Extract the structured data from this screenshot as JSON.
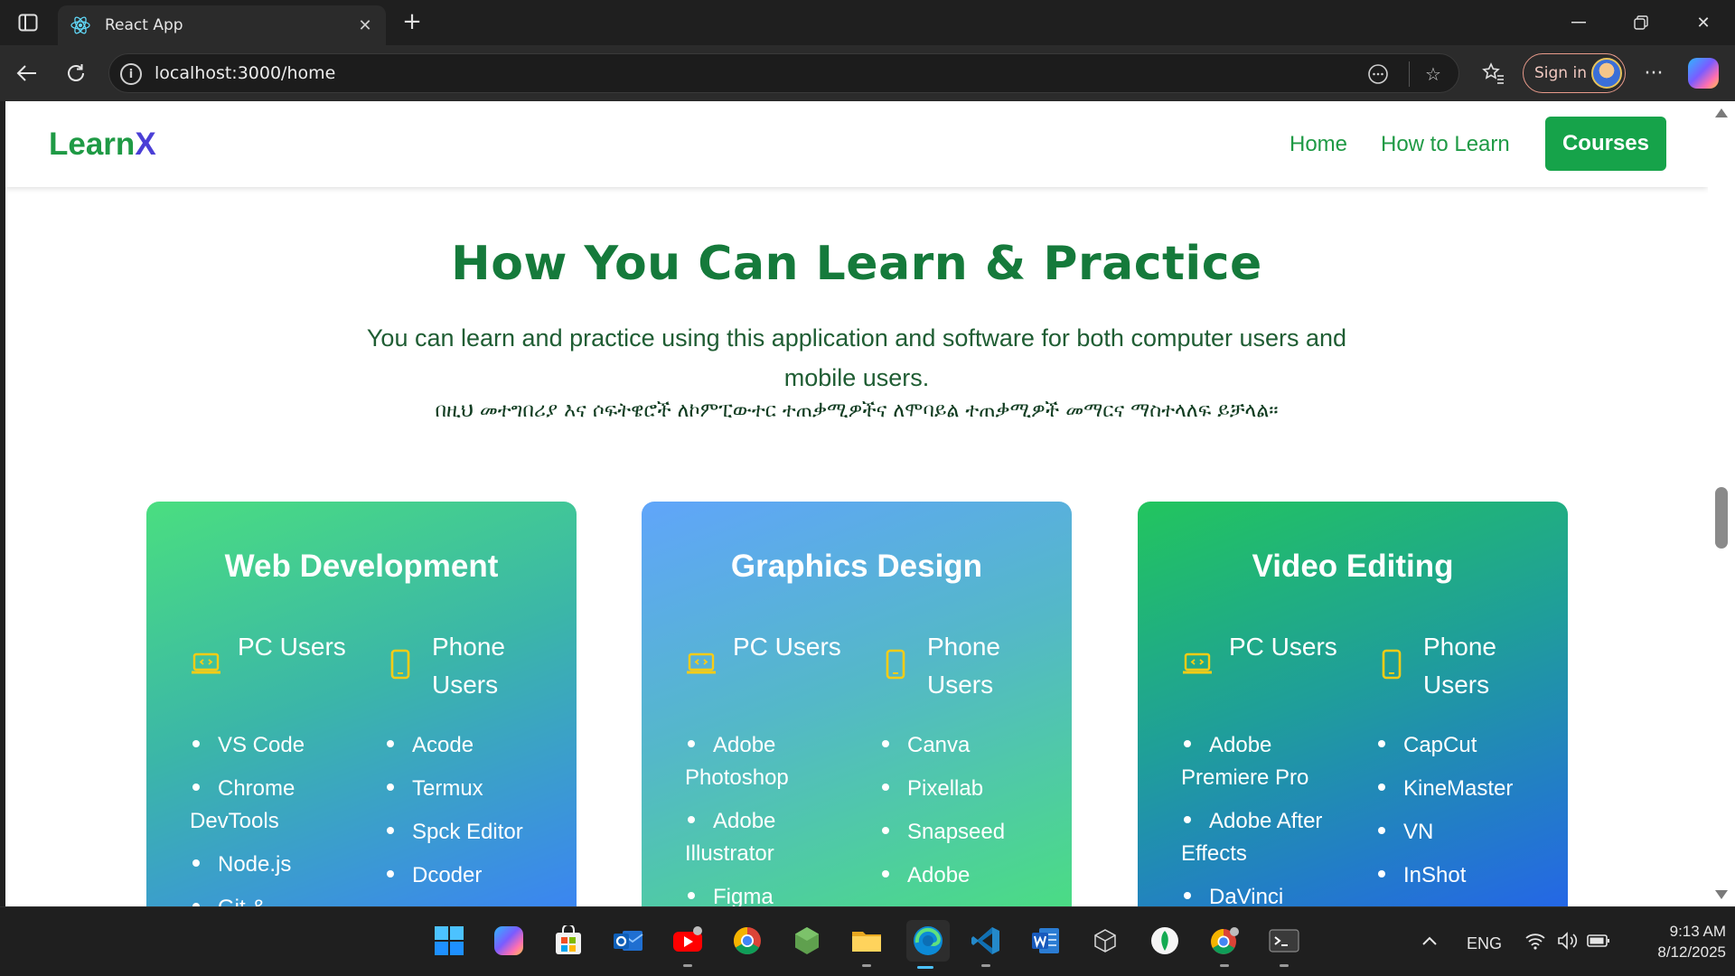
{
  "browser": {
    "tab_title": "React App",
    "url": "localhost:3000/home",
    "sign_in_label": "Sign in"
  },
  "site": {
    "logo_main": "Learn",
    "logo_accent": "X",
    "nav": {
      "home": "Home",
      "how_to_learn": "How to Learn",
      "courses": "Courses"
    },
    "hero": {
      "title": "How You Can Learn & Practice",
      "description": "You can learn and practice using this application and software for both computer users and mobile users.",
      "amharic": "በዚህ መተግበሪያ እና ሶፍትዌሮች ለኮምፒውተር ተጠቃሚዎችና ለሞባይል ተጠቃሚዎች መማርና ማስተላለፍ ይቻላል።"
    },
    "cards": [
      {
        "title": "Web Development",
        "pc_label": "PC Users",
        "phone_label": "Phone Users",
        "pc_items": [
          "VS Code",
          "Chrome DevTools",
          "Node.js",
          "Git &"
        ],
        "phone_items": [
          "Acode",
          "Termux",
          "Spck Editor",
          "Dcoder"
        ]
      },
      {
        "title": "Graphics Design",
        "pc_label": "PC Users",
        "phone_label": "Phone Users",
        "pc_items": [
          "Adobe Photoshop",
          "Adobe Illustrator",
          "Figma"
        ],
        "phone_items": [
          "Canva",
          "Pixellab",
          "Snapseed",
          "Adobe"
        ]
      },
      {
        "title": "Video Editing",
        "pc_label": "PC Users",
        "phone_label": "Phone Users",
        "pc_items": [
          "Adobe Premiere Pro",
          "Adobe After Effects",
          "DaVinci"
        ],
        "phone_items": [
          "CapCut",
          "KineMaster",
          "VN",
          "InShot"
        ]
      }
    ]
  },
  "taskbar": {
    "language": "ENG",
    "time": "9:13 AM",
    "date": "8/12/2025"
  },
  "colors": {
    "brand_green": "#1f9a45",
    "logo_x": "#4b3fd6",
    "courses_button": "#16a34a",
    "title_green": "#157a3b",
    "icon_yellow": "#facc15"
  }
}
